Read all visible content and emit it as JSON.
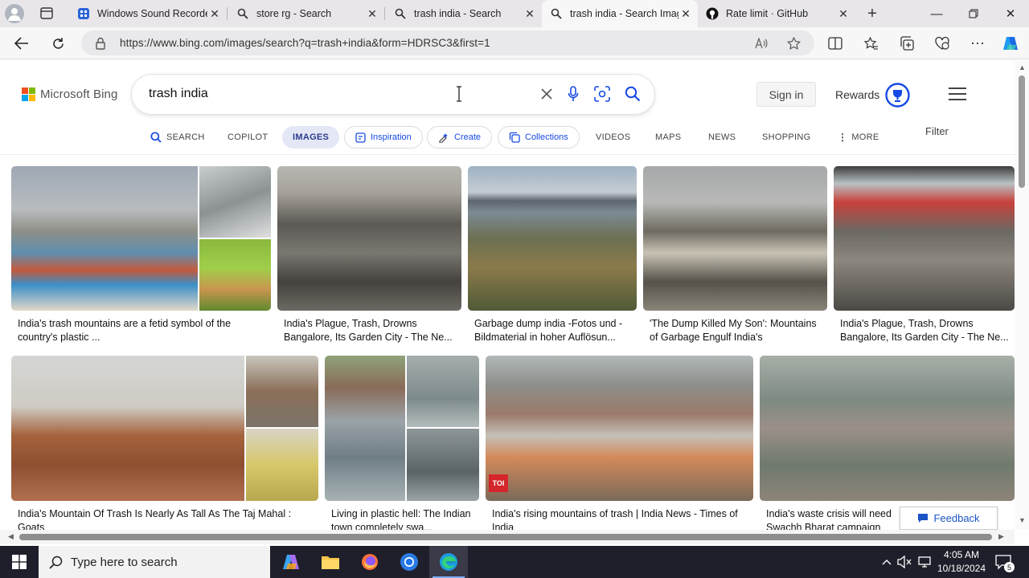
{
  "browser": {
    "tabs": [
      {
        "label": "Windows Sound Recorder",
        "icon": "recorder-icon"
      },
      {
        "label": "store rg - Search",
        "icon": "search-icon"
      },
      {
        "label": "trash india - Search",
        "icon": "search-icon"
      },
      {
        "label": "trash india - Search Images",
        "icon": "search-icon"
      },
      {
        "label": "Rate limit · GitHub",
        "icon": "github-icon"
      }
    ],
    "active_tab": 3,
    "url": "https://www.bing.com/images/search?q=trash+india&form=HDRSC3&first=1"
  },
  "header": {
    "logo_text": "Microsoft Bing",
    "query": "trash india",
    "sign_in": "Sign in",
    "rewards": "Rewards"
  },
  "scopes": [
    {
      "label": "SEARCH",
      "icon": "search-icon"
    },
    {
      "label": "COPILOT"
    },
    {
      "label": "IMAGES",
      "active": true
    },
    {
      "label": "Inspiration",
      "icon": "inspiration-icon",
      "pill": true
    },
    {
      "label": "Create",
      "icon": "create-icon",
      "pill": true
    },
    {
      "label": "Collections",
      "icon": "collections-icon",
      "pill": true
    },
    {
      "label": "VIDEOS"
    },
    {
      "label": "MAPS"
    },
    {
      "label": "NEWS"
    },
    {
      "label": "SHOPPING"
    },
    {
      "label": "MORE",
      "icon": "more-icon"
    }
  ],
  "filter_label": "Filter",
  "results": [
    {
      "caption": "India's trash mountains are a fetid symbol of the country's plastic ..."
    },
    {
      "caption": "India's Plague, Trash, Drowns Bangalore, Its Garden City - The Ne..."
    },
    {
      "caption": "Garbage dump india -Fotos und -Bildmaterial in hoher Auflösun..."
    },
    {
      "caption": "'The Dump Killed My Son': Mountains of Garbage Engulf India's"
    },
    {
      "caption": "India's Plague, Trash, Drowns Bangalore, Its Garden City - The Ne..."
    },
    {
      "caption": "India's Mountain Of Trash Is Nearly As Tall As The Taj Mahal : Goats"
    },
    {
      "caption": "Living in plastic hell: The Indian town completely swa..."
    },
    {
      "caption": "India's rising mountains of trash | India News - Times of India"
    },
    {
      "caption": "India's waste crisis will need Swachh Bharat campaign"
    }
  ],
  "feedback_label": "Feedback",
  "taskbar": {
    "search_placeholder": "Type here to search",
    "time": "4:05 AM",
    "date": "10/18/2024",
    "notification_count": "5"
  },
  "colors": {
    "accent": "#174ae4",
    "tabbar": "#e9e6ea",
    "taskbar": "#1f1f2b",
    "active_scope_bg": "#e3e7f6"
  }
}
